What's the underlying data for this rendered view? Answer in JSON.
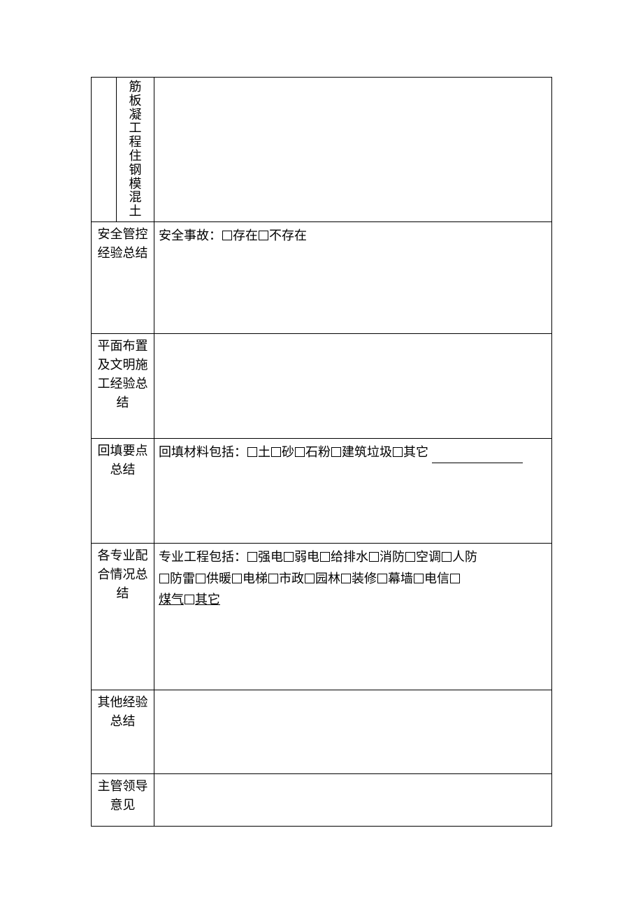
{
  "rows": {
    "r1_inner": "筋板凝工程住钢模混土",
    "r2_label": "安全管控经验总结",
    "r2_prefix": "安全事故：",
    "r2_opt1": "存在",
    "r2_opt2": "不存在",
    "r3_label": "平面布置及文明施工经验总结",
    "r4_label": "回填要点总结",
    "r4_prefix": "回填材料包括：",
    "r4_opt1": "土",
    "r4_opt2": "砂",
    "r4_opt3": "石粉",
    "r4_opt4": "建筑垃圾",
    "r4_opt5": "其它",
    "r5_label": "各专业配合情况总结",
    "r5_prefix": "专业工程包括：",
    "r5_opt1": "强电",
    "r5_opt2": "弱电",
    "r5_opt3": "给排水",
    "r5_opt4": "消防",
    "r5_opt5": "空调",
    "r5_opt6": "人防",
    "r5_opt7": "防雷",
    "r5_opt8": "供暖",
    "r5_opt9": "电梯",
    "r5_opt10": "市政",
    "r5_opt11": "园林",
    "r5_opt12": "装修",
    "r5_opt13": "幕墙",
    "r5_opt14": "电信",
    "r5_opt15": "煤气",
    "r5_opt16": "其它",
    "r6_label": "其他经验总结",
    "r7_label": "主管领导意见"
  }
}
